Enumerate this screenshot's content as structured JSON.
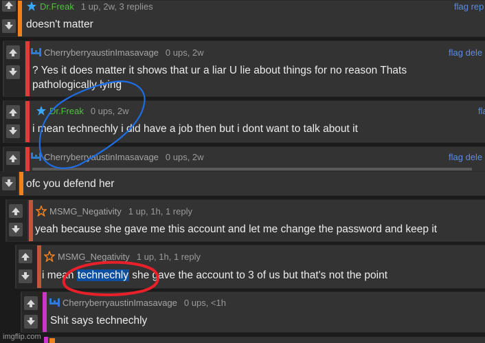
{
  "comments": [
    {
      "user": "Dr.Freak",
      "meta": "1 up, 2w, 3 replies",
      "actions": "flag rep",
      "text": "doesn't matter",
      "avatar": "star-icon"
    },
    {
      "user": "CherryberryaustinImasavage",
      "meta": "0 ups, 2w",
      "actions": "flag dele",
      "text_line1": "? Yes it does matter it shows that ur a liar U lie about things for no reason Thats",
      "text_line2": "pathologically lying",
      "avatar": "pixel-bird-icon"
    },
    {
      "user": "Dr.Freak",
      "meta": "0 ups, 2w",
      "actions": "fla",
      "text": "i mean technechly i did have a job then but i dont want to talk about it",
      "avatar": "star-icon"
    },
    {
      "user": "CherryberryaustinImasavage",
      "meta": "0 ups, 2w",
      "actions": "flag dele",
      "avatar": "pixel-bird-icon"
    },
    {
      "text": "ofc you defend her"
    },
    {
      "user": "MSMG_Negativity",
      "meta": "1 up, 1h, 1 reply",
      "text": "yeah because she gave me this account and let me change the password and keep it",
      "avatar": "star-icon"
    },
    {
      "user": "MSMG_Negativity",
      "meta": "1 up, 1h, 1 reply",
      "text_pre": "i mean ",
      "text_highlight": "technechly",
      "text_post": " she gave the account to 3 of us but that's not the point",
      "avatar": "star-icon"
    },
    {
      "user": "CherryberryaustinImasavage",
      "meta": "0 ups, <1h",
      "text": "Shit says technechly",
      "avatar": "pixel-bird-icon"
    }
  ],
  "watermark": "imgflip.com",
  "colors": {
    "orange": "#f0821e",
    "red": "#e03c3c",
    "brownish": "#c0563a",
    "magenta": "#c837c8",
    "link": "#5b8de0",
    "annotation_blue": "#1d6ee6",
    "annotation_red": "#e8202a"
  }
}
